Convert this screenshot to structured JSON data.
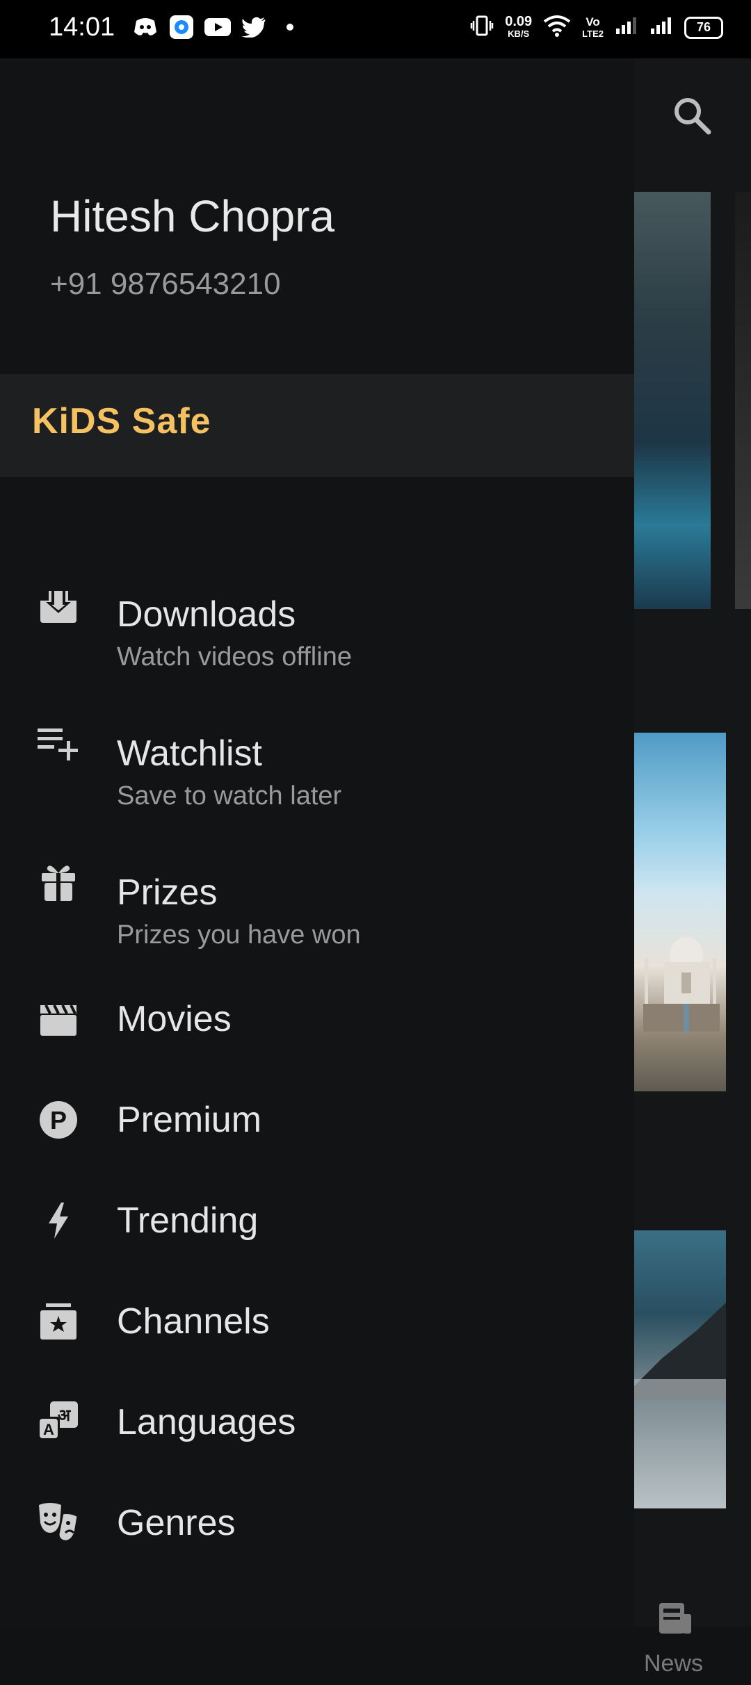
{
  "status_bar": {
    "time": "14:01",
    "left_icons": [
      "discord-icon",
      "messenger-icon",
      "youtube-icon",
      "twitter-icon",
      "dot-icon"
    ],
    "net_speed_value": "0.09",
    "net_speed_unit": "KB/S",
    "volte_label_top": "Vo",
    "volte_label_bottom": "LTE2",
    "battery": "76"
  },
  "profile": {
    "name": "Hitesh Chopra",
    "phone": "+91 9876543210"
  },
  "kids_banner": {
    "label": "KiDS Safe",
    "color": "#f6c160"
  },
  "menu": [
    {
      "title": "Downloads",
      "subtitle": "Watch videos offline",
      "icon": "download-icon"
    },
    {
      "title": "Watchlist",
      "subtitle": "Save to watch later",
      "icon": "playlist-add-icon"
    },
    {
      "title": "Prizes",
      "subtitle": "Prizes you have won",
      "icon": "gift-icon"
    },
    {
      "title": "Movies",
      "icon": "clapperboard-icon"
    },
    {
      "title": "Premium",
      "icon": "premium-icon"
    },
    {
      "title": "Trending",
      "icon": "lightning-icon"
    },
    {
      "title": "Channels",
      "icon": "channels-icon"
    },
    {
      "title": "Languages",
      "icon": "languages-icon"
    },
    {
      "title": "Genres",
      "icon": "theater-masks-icon"
    }
  ],
  "background_app": {
    "bottom_tab_label": "News"
  }
}
